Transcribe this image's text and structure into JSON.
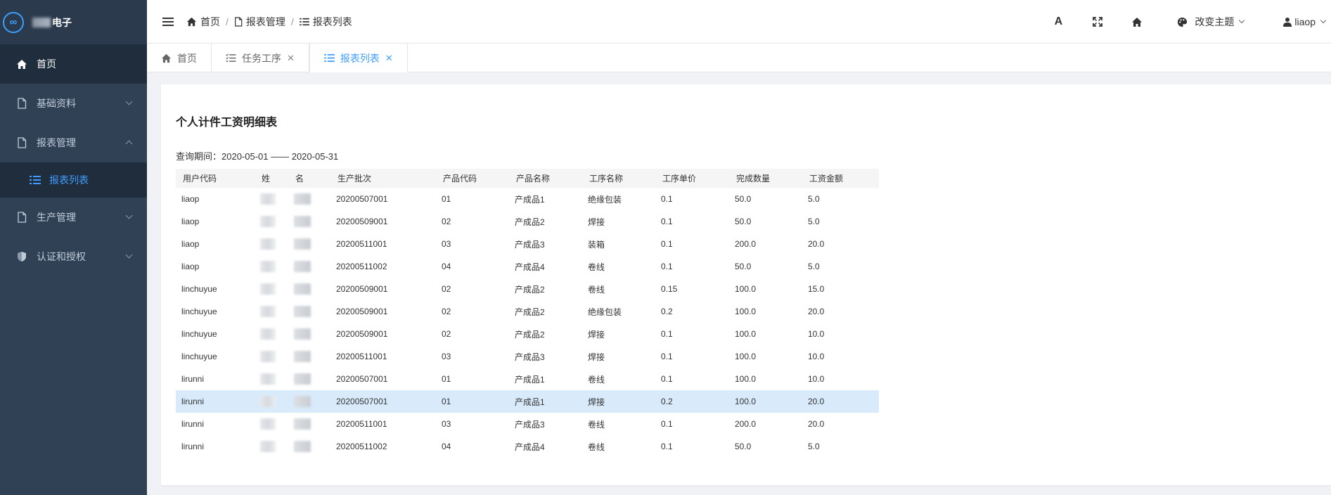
{
  "app": {
    "logo_text": "电子"
  },
  "sidebar": {
    "items": [
      {
        "label": "首页"
      },
      {
        "label": "基础资料"
      },
      {
        "label": "报表管理"
      },
      {
        "label": "报表列表"
      },
      {
        "label": "生产管理"
      },
      {
        "label": "认证和授权"
      }
    ]
  },
  "breadcrumb": [
    "首页",
    "报表管理",
    "报表列表"
  ],
  "topbar": {
    "font_label": "A",
    "theme_label": "改变主题",
    "user_name": "liaop"
  },
  "tabs": [
    {
      "label": "首页"
    },
    {
      "label": "任务工序"
    },
    {
      "label": "报表列表"
    }
  ],
  "report": {
    "title": "个人计件工资明细表",
    "period": "查询期间：2020-05-01 —— 2020-05-31",
    "columns": [
      "用户代码",
      "姓",
      "名",
      "生产批次",
      "产品代码",
      "产品名称",
      "工序名称",
      "工序单价",
      "完成数量",
      "工资金额"
    ],
    "rows": [
      [
        "liaop",
        "",
        "",
        "20200507001",
        "01",
        "产成品1",
        "绝缘包装",
        "0.1",
        "50.0",
        "5.0"
      ],
      [
        "liaop",
        "",
        "",
        "20200509001",
        "02",
        "产成品2",
        "焊接",
        "0.1",
        "50.0",
        "5.0"
      ],
      [
        "liaop",
        "",
        "",
        "20200511001",
        "03",
        "产成品3",
        "装箱",
        "0.1",
        "200.0",
        "20.0"
      ],
      [
        "liaop",
        "",
        "",
        "20200511002",
        "04",
        "产成品4",
        "卷线",
        "0.1",
        "50.0",
        "5.0"
      ],
      [
        "linchuyue",
        "",
        "",
        "20200509001",
        "02",
        "产成品2",
        "卷线",
        "0.15",
        "100.0",
        "15.0"
      ],
      [
        "linchuyue",
        "",
        "",
        "20200509001",
        "02",
        "产成品2",
        "绝缘包装",
        "0.2",
        "100.0",
        "20.0"
      ],
      [
        "linchuyue",
        "",
        "",
        "20200509001",
        "02",
        "产成品2",
        "焊接",
        "0.1",
        "100.0",
        "10.0"
      ],
      [
        "linchuyue",
        "",
        "",
        "20200511001",
        "03",
        "产成品3",
        "焊接",
        "0.1",
        "100.0",
        "10.0"
      ],
      [
        "lirunni",
        "",
        "",
        "20200507001",
        "01",
        "产成品1",
        "卷线",
        "0.1",
        "100.0",
        "10.0"
      ],
      [
        "lirunni",
        "",
        "",
        "20200507001",
        "01",
        "产成品1",
        "焊接",
        "0.2",
        "100.0",
        "20.0"
      ],
      [
        "lirunni",
        "",
        "",
        "20200511001",
        "03",
        "产成品3",
        "卷线",
        "0.1",
        "200.0",
        "20.0"
      ],
      [
        "lirunni",
        "",
        "",
        "20200511002",
        "04",
        "产成品4",
        "卷线",
        "0.1",
        "50.0",
        "5.0"
      ]
    ],
    "selected_row": 9
  },
  "colors": {
    "sidebar_bg": "#304156",
    "accent": "#409eff",
    "selected_row": "#d9ebfb"
  }
}
